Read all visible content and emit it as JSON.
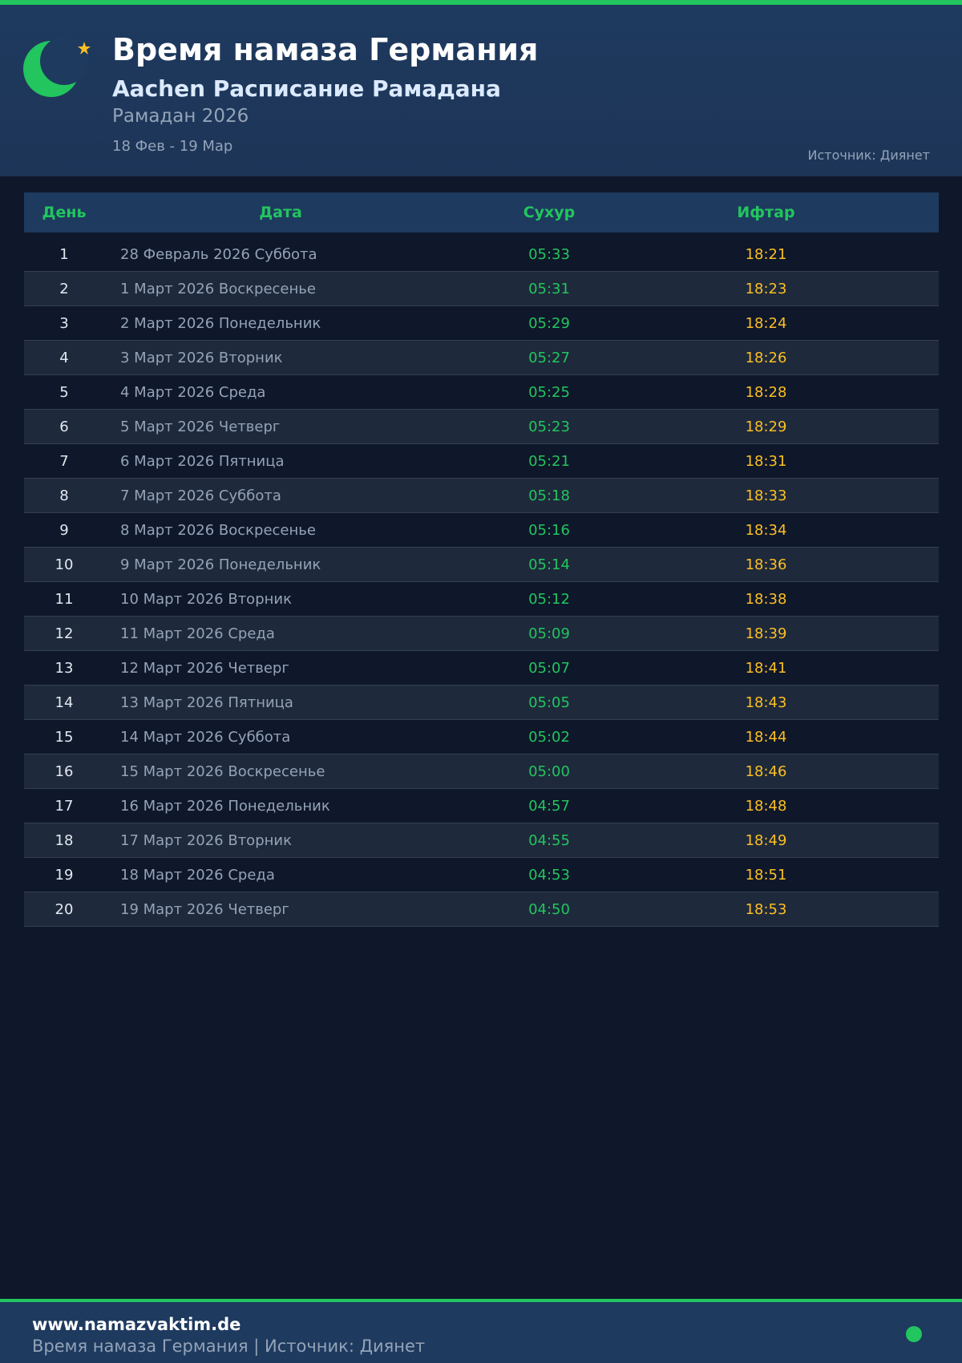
{
  "header": {
    "title": "Время намаза Германия",
    "subtitle": "Aachen Расписание Рамадана",
    "year": "Рамадан 2026",
    "range": "18 Фев - 19 Мар",
    "source": "Источник: Диянет"
  },
  "table": {
    "headers": {
      "day": "День",
      "date": "Дата",
      "suhur": "Сухур",
      "iftar": "Ифтар"
    },
    "rows": [
      {
        "day": "1",
        "date": "28 Февраль 2026 Суббота",
        "suhur": "05:33",
        "iftar": "18:21"
      },
      {
        "day": "2",
        "date": "1 Март 2026 Воскресенье",
        "suhur": "05:31",
        "iftar": "18:23"
      },
      {
        "day": "3",
        "date": "2 Март 2026 Понедельник",
        "suhur": "05:29",
        "iftar": "18:24"
      },
      {
        "day": "4",
        "date": "3 Март 2026 Вторник",
        "suhur": "05:27",
        "iftar": "18:26"
      },
      {
        "day": "5",
        "date": "4 Март 2026 Среда",
        "suhur": "05:25",
        "iftar": "18:28"
      },
      {
        "day": "6",
        "date": "5 Март 2026 Четверг",
        "suhur": "05:23",
        "iftar": "18:29"
      },
      {
        "day": "7",
        "date": "6 Март 2026 Пятница",
        "suhur": "05:21",
        "iftar": "18:31"
      },
      {
        "day": "8",
        "date": "7 Март 2026 Суббота",
        "suhur": "05:18",
        "iftar": "18:33"
      },
      {
        "day": "9",
        "date": "8 Март 2026 Воскресенье",
        "suhur": "05:16",
        "iftar": "18:34"
      },
      {
        "day": "10",
        "date": "9 Март 2026 Понедельник",
        "suhur": "05:14",
        "iftar": "18:36"
      },
      {
        "day": "11",
        "date": "10 Март 2026 Вторник",
        "suhur": "05:12",
        "iftar": "18:38"
      },
      {
        "day": "12",
        "date": "11 Март 2026 Среда",
        "suhur": "05:09",
        "iftar": "18:39"
      },
      {
        "day": "13",
        "date": "12 Март 2026 Четверг",
        "suhur": "05:07",
        "iftar": "18:41"
      },
      {
        "day": "14",
        "date": "13 Март 2026 Пятница",
        "suhur": "05:05",
        "iftar": "18:43"
      },
      {
        "day": "15",
        "date": "14 Март 2026 Суббота",
        "suhur": "05:02",
        "iftar": "18:44"
      },
      {
        "day": "16",
        "date": "15 Март 2026 Воскресенье",
        "suhur": "05:00",
        "iftar": "18:46"
      },
      {
        "day": "17",
        "date": "16 Март 2026 Понедельник",
        "suhur": "04:57",
        "iftar": "18:48"
      },
      {
        "day": "18",
        "date": "17 Март 2026 Вторник",
        "suhur": "04:55",
        "iftar": "18:49"
      },
      {
        "day": "19",
        "date": "18 Март 2026 Среда",
        "suhur": "04:53",
        "iftar": "18:51"
      },
      {
        "day": "20",
        "date": "19 Март 2026 Четверг",
        "suhur": "04:50",
        "iftar": "18:53"
      }
    ]
  },
  "footer": {
    "site": "www.namazvaktim.de",
    "text": "Время намаза Германия | Источник: Диянет"
  },
  "colors": {
    "accent": "#22c55e",
    "iftar": "#fbbf24",
    "header_bg": "#1e3a5f",
    "page_bg": "#0f172a"
  },
  "icons": {
    "logo": "crescent-star-icon",
    "status": "status-dot-icon"
  }
}
